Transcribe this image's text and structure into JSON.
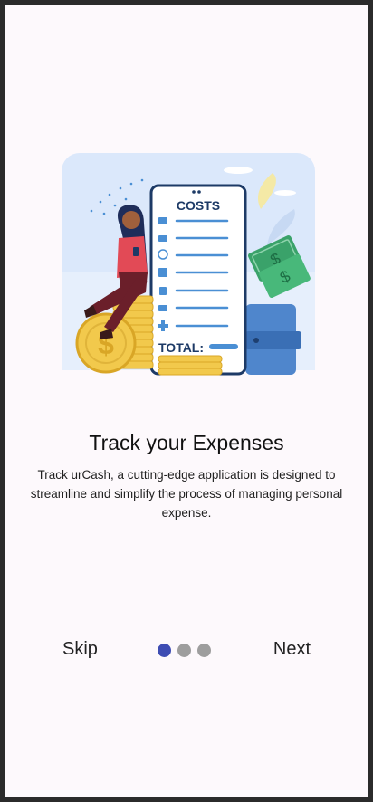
{
  "onboarding": {
    "illustration": {
      "costs_label": "COSTS",
      "total_label": "TOTAL:"
    },
    "title": "Track your Expenses",
    "description": "Track urCash, a cutting-edge application is designed to streamline and simplify the process of managing personal expense.",
    "skip_label": "Skip",
    "next_label": "Next",
    "page_indicator": {
      "current": 1,
      "total": 3
    },
    "colors": {
      "active_dot": "#3e4db3",
      "inactive_dot": "#9e9e9e"
    }
  }
}
